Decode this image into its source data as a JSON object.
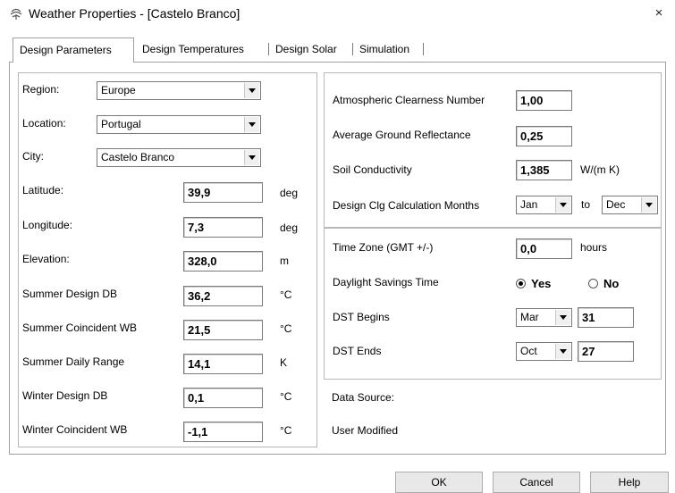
{
  "window": {
    "title": "Weather Properties - [Castelo Branco]",
    "close_glyph": "×"
  },
  "tabs": [
    {
      "label": "Design Parameters",
      "active": true
    },
    {
      "label": "Design Temperatures"
    },
    {
      "label": "Design Solar"
    },
    {
      "label": "Simulation"
    }
  ],
  "left": {
    "region": {
      "label": "Region:",
      "value": "Europe"
    },
    "location": {
      "label": "Location:",
      "value": "Portugal"
    },
    "city": {
      "label": "City:",
      "value": "Castelo Branco"
    },
    "latitude": {
      "label": "Latitude:",
      "value": "39,9",
      "unit": "deg"
    },
    "longitude": {
      "label": "Longitude:",
      "value": "7,3",
      "unit": "deg"
    },
    "elevation": {
      "label": "Elevation:",
      "value": "328,0",
      "unit": "m"
    },
    "summer_db": {
      "label": "Summer Design DB",
      "value": "36,2",
      "unit": "°C"
    },
    "summer_wb": {
      "label": "Summer Coincident WB",
      "value": "21,5",
      "unit": "°C"
    },
    "summer_range": {
      "label": "Summer Daily Range",
      "value": "14,1",
      "unit": "K"
    },
    "winter_db": {
      "label": "Winter Design DB",
      "value": "0,1",
      "unit": "°C"
    },
    "winter_wb": {
      "label": "Winter Coincident WB",
      "value": "-1,1",
      "unit": "°C"
    }
  },
  "right": {
    "clearness": {
      "label": "Atmospheric Clearness Number",
      "value": "1,00"
    },
    "reflectance": {
      "label": "Average Ground Reflectance",
      "value": "0,25"
    },
    "soil": {
      "label": "Soil Conductivity",
      "value": "1,385",
      "unit": "W/(m K)"
    },
    "clg_months": {
      "label": "Design Clg Calculation Months",
      "from": "Jan",
      "to_label": "to",
      "to": "Dec"
    },
    "timezone": {
      "label": "Time Zone (GMT +/-)",
      "value": "0,0",
      "unit": "hours"
    },
    "dst": {
      "label": "Daylight Savings Time",
      "yes": "Yes",
      "no": "No",
      "selected": "Yes"
    },
    "dst_begins": {
      "label": "DST Begins",
      "month": "Mar",
      "day": "31"
    },
    "dst_ends": {
      "label": "DST Ends",
      "month": "Oct",
      "day": "27"
    },
    "data_source": "Data Source:",
    "user_modified": "User Modified"
  },
  "buttons": {
    "ok": "OK",
    "cancel": "Cancel",
    "help": "Help"
  }
}
